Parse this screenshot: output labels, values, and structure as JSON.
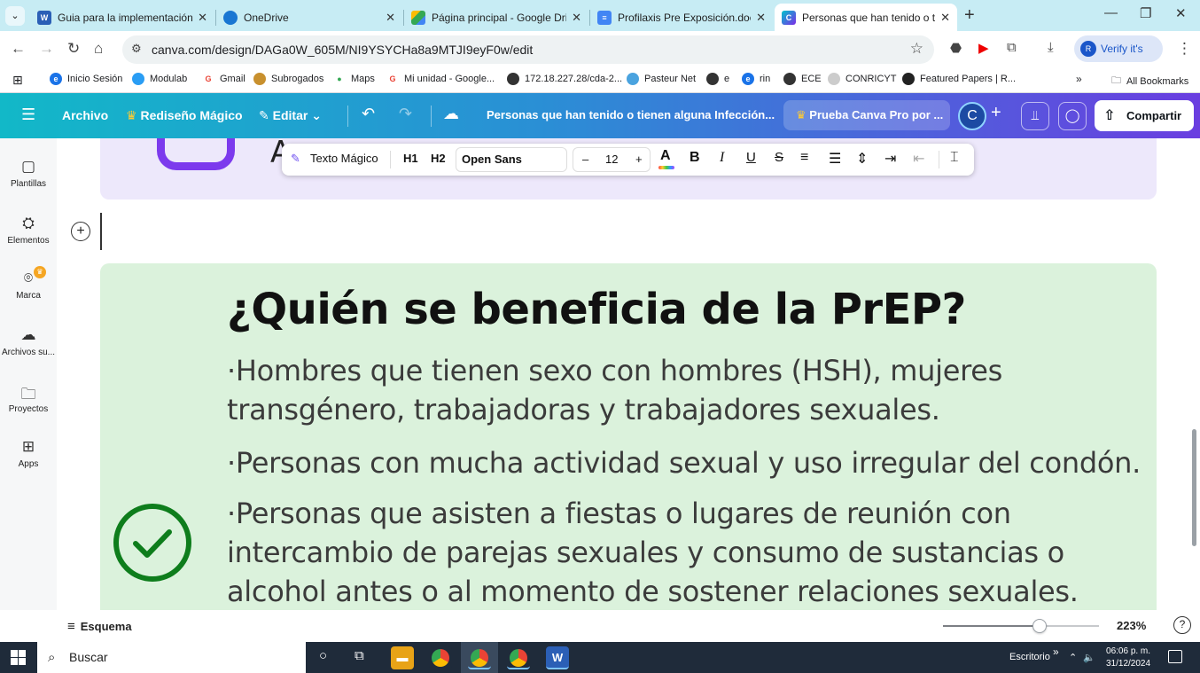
{
  "browser": {
    "tabs": [
      {
        "title": "Guia para la implementación de",
        "active": false
      },
      {
        "title": "OneDrive",
        "active": false
      },
      {
        "title": "Página principal - Google Drive",
        "active": false
      },
      {
        "title": "Profilaxis Pre Exposición.docx -",
        "active": false
      },
      {
        "title": "Personas que han tenido o tien",
        "active": true
      }
    ],
    "url": "canva.com/design/DAGa0W_605M/NI9YSYCHa8a9MTJI9eyF0w/edit",
    "verify_label": "Verify it's you",
    "bookmarks": [
      "Inicio Sesión",
      "Modulab",
      "Gmail",
      "Subrogados",
      "Maps",
      "Mi unidad - Google...",
      "172.18.227.28/cda-2...",
      "Pasteur Net",
      "e",
      "rin",
      "ECE",
      "CONRICYT",
      "Featured Papers | R..."
    ],
    "all_bookmarks_label": "All Bookmarks"
  },
  "canva": {
    "archivo": "Archivo",
    "magic_resize": "Rediseño Mágico",
    "edit": "Editar",
    "doc_title": "Personas que han tenido o tienen alguna Infección...",
    "pro_trial": "Prueba Canva Pro por ...",
    "avatar_initial": "C",
    "share": "Compartir",
    "sidebar": [
      {
        "label": "Plantillas",
        "icon": "template-icon"
      },
      {
        "label": "Elementos",
        "icon": "elements-icon"
      },
      {
        "label": "Marca",
        "icon": "brand-icon"
      },
      {
        "label": "Archivos su...",
        "icon": "uploads-icon"
      },
      {
        "label": "Proyectos",
        "icon": "folder-icon"
      },
      {
        "label": "Apps",
        "icon": "apps-icon"
      }
    ],
    "text_toolbar": {
      "magic_text": "Texto Mágico",
      "h1": "H1",
      "h2": "H2",
      "font": "Open Sans",
      "size": "12"
    },
    "outline_label": "Esquema",
    "zoom_value": 0.62,
    "zoom_label": "223%"
  },
  "slide": {
    "top_text": "Agreg",
    "heading": "¿Quién se beneficia de la PrEP?",
    "paragraphs": [
      "·Hombres que tienen sexo con hombres (HSH), mujeres transgénero, trabajadoras y trabajadores sexuales.",
      "·Personas con mucha actividad sexual y uso irregular del condón.",
      "·Personas que asisten a fiestas o lugares de reunión con intercambio de parejas sexuales y consumo de sustancias o alcohol antes o al momento de sostener relaciones sexuales."
    ],
    "accent_green": "#0e7d1c",
    "accent_purple": "#7c3aed",
    "panel_green": "#dbf2dc",
    "panel_purple": "#ede8fb"
  },
  "taskbar": {
    "search_placeholder": "Buscar",
    "desktop_label": "Escritorio",
    "time": "06:06 p. m.",
    "date": "31/12/2024"
  }
}
